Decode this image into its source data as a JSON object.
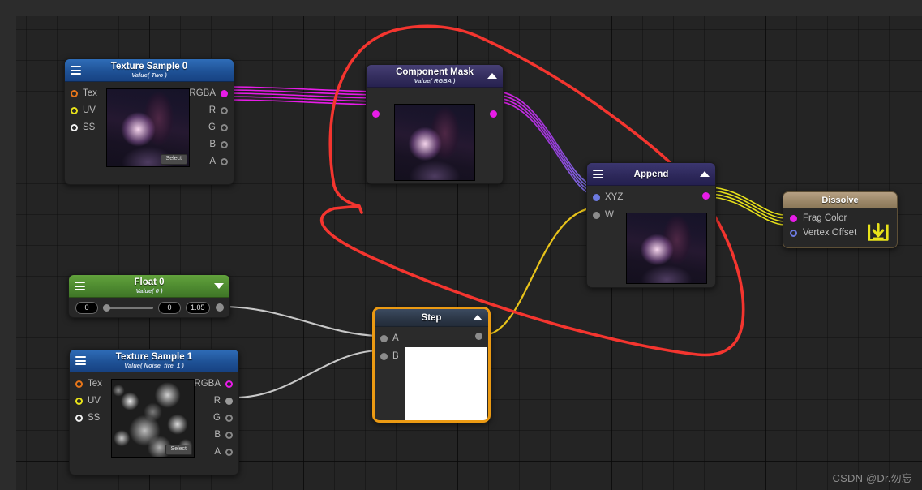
{
  "app": {
    "watermark": "CSDN @Dr.勿忘"
  },
  "nodes": {
    "texture_sample_0": {
      "title": "Texture Sample 0",
      "subtitle": "Value( Two )",
      "inputs": [
        {
          "label": "Tex",
          "color": "#e8761a"
        },
        {
          "label": "UV",
          "color": "#e8e21a"
        },
        {
          "label": "SS",
          "color": "#f0f0f0"
        }
      ],
      "outputs": [
        {
          "label": "RGBA",
          "color": "#e81ce8",
          "filled": true
        },
        {
          "label": "R",
          "color": "#8c8c8c",
          "filled": false
        },
        {
          "label": "G",
          "color": "#8c8c8c",
          "filled": false
        },
        {
          "label": "B",
          "color": "#8c8c8c",
          "filled": false
        },
        {
          "label": "A",
          "color": "#8c8c8c",
          "filled": false
        }
      ],
      "select_label": "Select",
      "thumbnail": "anime-preview"
    },
    "texture_sample_1": {
      "title": "Texture Sample 1",
      "subtitle": "Value( Noise_fire_1 )",
      "inputs": [
        {
          "label": "Tex",
          "color": "#e8761a"
        },
        {
          "label": "UV",
          "color": "#e8e21a"
        },
        {
          "label": "SS",
          "color": "#f0f0f0"
        }
      ],
      "outputs": [
        {
          "label": "RGBA",
          "color": "#e81ce8",
          "filled": false
        },
        {
          "label": "R",
          "color": "#9a9a9a",
          "filled": true
        },
        {
          "label": "G",
          "color": "#8c8c8c",
          "filled": false
        },
        {
          "label": "B",
          "color": "#8c8c8c",
          "filled": false
        },
        {
          "label": "A",
          "color": "#8c8c8c",
          "filled": false
        }
      ],
      "select_label": "Select",
      "thumbnail": "noise-preview"
    },
    "component_mask": {
      "title": "Component Mask",
      "subtitle": "Value( RGBA )",
      "input_color": "#e81ce8",
      "output_color": "#e81ce8",
      "thumbnail": "anime-preview"
    },
    "append": {
      "title": "Append",
      "inputs": [
        {
          "label": "XYZ",
          "color": "#6c7ae0",
          "filled": true
        },
        {
          "label": "W",
          "color": "#8c8c8c",
          "filled": true
        }
      ],
      "output_color": "#e81ce8",
      "thumbnail": "anime-preview"
    },
    "step": {
      "title": "Step",
      "inputs": [
        {
          "label": "A",
          "color": "#8c8c8c",
          "filled": true
        },
        {
          "label": "B",
          "color": "#8c8c8c",
          "filled": true
        }
      ],
      "output_color": "#8c8c8c",
      "selected": true,
      "selection_color": "#eb9a13",
      "preview_color": "#ffffff"
    },
    "float_0": {
      "title": "Float 0",
      "subtitle": "Value( 0 )",
      "value_field": "0",
      "min_field": "0",
      "max_field": "1.05",
      "output_color": "#8e8e8e"
    },
    "dissolve": {
      "title": "Dissolve",
      "inputs": [
        {
          "label": "Frag Color",
          "color": "#e81ce8",
          "filled": true
        },
        {
          "label": "Vertex Offset",
          "color": "#6c7ae0",
          "filled": false
        }
      ],
      "save_icon": "save-download-icon",
      "save_icon_color": "#e8e21a"
    }
  },
  "annotation": {
    "color": "#f4352f",
    "shape": "hand-drawn-lasso-circle"
  },
  "wire_colors": {
    "rgba_magenta": "#e81ce8",
    "mask_to_append": "#8b3bd6",
    "append_to_dissolve": "#e8e21a",
    "step_to_append": "#e8c31a",
    "float_gray": "#c8c8c8"
  }
}
